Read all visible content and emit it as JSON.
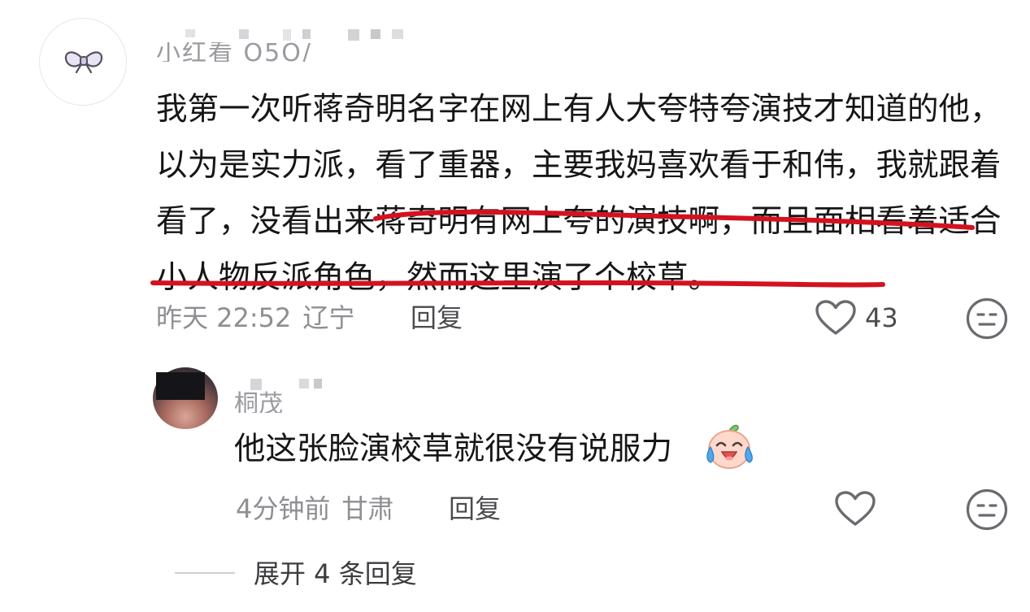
{
  "main_comment": {
    "username": "小红看 O5O/",
    "text": "我第一次听蒋奇明名字在网上有人大夸特夸演技才知道的他，以为是实力派，看了重器，主要我妈喜欢看于和伟，我就跟着看了，没看出来蒋奇明有网上夸的演技啊，而且面相看着适合小人物反派角色，然而这里演了个校草。",
    "time": "昨天 22:52",
    "location": "辽宁",
    "reply_label": "回复",
    "like_count": "43",
    "highlight_color": "#d4121f"
  },
  "reply_comment": {
    "username": "桐茂",
    "text": "他这张脸演校草就很没有说服力",
    "emoji": "crying-laughing-emoji",
    "time": "4分钟前",
    "location": "甘肃",
    "reply_label": "回复"
  },
  "expand": {
    "label": "展开 4 条回复"
  },
  "icons": {
    "like": "heart-outline-icon",
    "dislike": "meh-face-icon",
    "avatar_main": "bow-icon"
  }
}
